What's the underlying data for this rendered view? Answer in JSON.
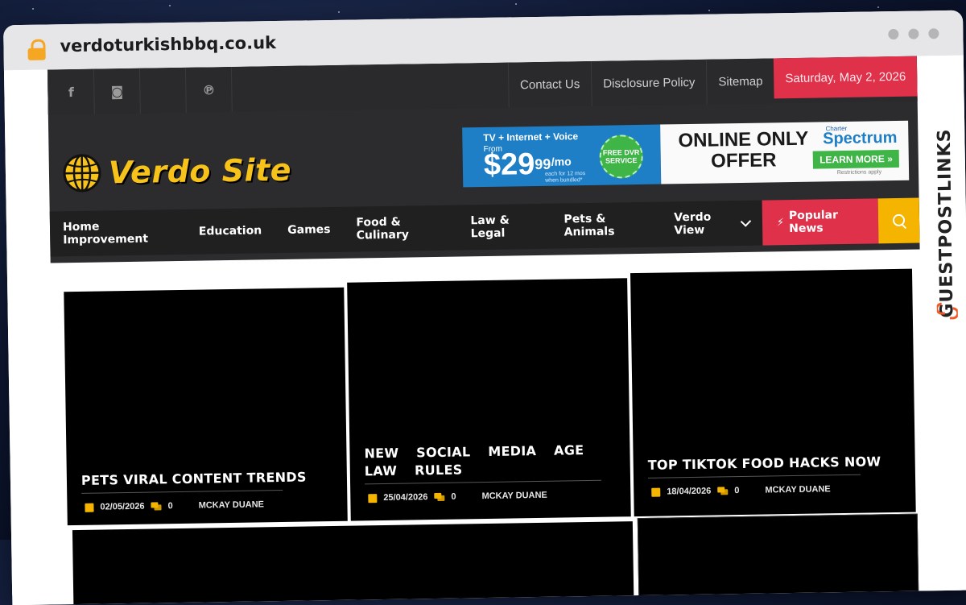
{
  "browser": {
    "url": "verdoturkishbbq.co.uk"
  },
  "site": {
    "social_icons": [
      "facebook-icon",
      "instagram-icon",
      "blank-icon",
      "pinterest-icon"
    ],
    "social_glyphs": [
      "f",
      "◙",
      "",
      "℗"
    ],
    "top_links": [
      "Contact Us",
      "Disclosure Policy",
      "Sitemap"
    ],
    "date": "Saturday, May 2, 2026",
    "logo_text": "Verdo Site",
    "ad": {
      "top_line": "TV + Internet + Voice",
      "from": "From",
      "price_dollars": "$29",
      "price_cents": "99",
      "per": "/mo",
      "fine_print": "each for 12 mos when bundled*",
      "seal": "FREE DVR SERVICE",
      "offer": "ONLINE ONLY OFFER",
      "brand_small": "Charter",
      "brand": "Spectrum",
      "cta": "LEARN MORE »",
      "restrictions": "Restrictions apply"
    },
    "nav": {
      "items": [
        "Home Improvement",
        "Education",
        "Games",
        "Food & Culinary",
        "Law & Legal",
        "Pets & Animals"
      ],
      "dropdown": "Verdo View",
      "popular": "Popular News"
    }
  },
  "posts": [
    {
      "title": "PETS VIRAL CONTENT TRENDS",
      "date": "02/05/2026",
      "comments": "0",
      "author": "MCKAY DUANE"
    },
    {
      "title": "NEW SOCIAL MEDIA AGE LAW RULES",
      "date": "25/04/2026",
      "comments": "0",
      "author": "MCKAY DUANE"
    },
    {
      "title": "TOP TIKTOK FOOD HACKS NOW",
      "date": "18/04/2026",
      "comments": "0",
      "author": "MCKAY DUANE"
    }
  ],
  "brand_overlay": "GUESTPOSTLINKS",
  "colors": {
    "accent_red": "#e0314b",
    "accent_yellow": "#f5b400",
    "logo_yellow": "#f7c21a",
    "header_dark": "#2c2c2e"
  }
}
